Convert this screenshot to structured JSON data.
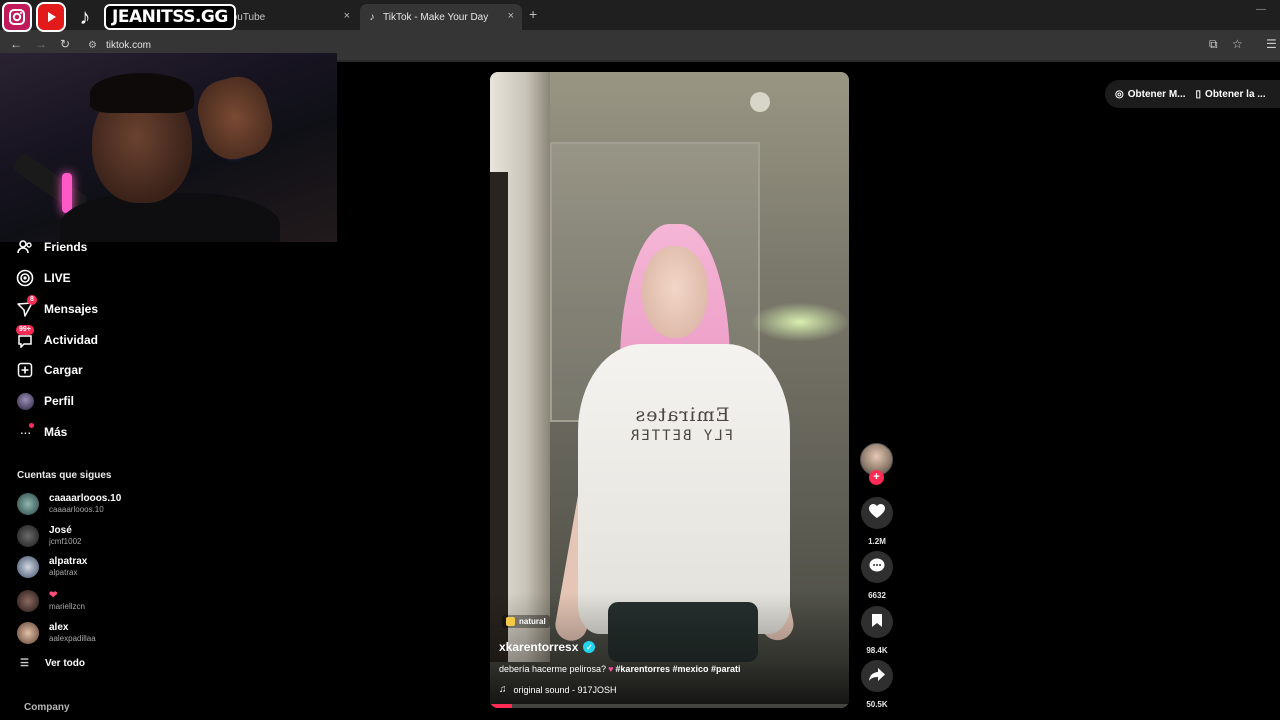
{
  "browser": {
    "tabs": [
      {
        "label": "(163) YouTube",
        "close": "×"
      },
      {
        "label": "TikTok - Make Your Day",
        "close": "×"
      }
    ],
    "new_tab": "+",
    "window_minimize": "—",
    "url": "tiktok.com"
  },
  "overlay": {
    "channel_name": "JEANITSS.GG"
  },
  "sidebar": {
    "nav": [
      {
        "label": "Friends",
        "icon": "friends-icon"
      },
      {
        "label": "LIVE",
        "icon": "live-icon"
      },
      {
        "label": "Mensajes",
        "icon": "messages-icon",
        "badge": "8"
      },
      {
        "label": "Actividad",
        "icon": "activity-icon",
        "badge": "99+"
      },
      {
        "label": "Cargar",
        "icon": "upload-icon"
      },
      {
        "label": "Perfil",
        "icon": "profile-icon"
      },
      {
        "label": "Más",
        "icon": "more-icon"
      }
    ],
    "following_title": "Cuentas que sigues",
    "following": [
      {
        "name": "caaaarlooos.10",
        "username": "caaaarlooos.10"
      },
      {
        "name": "José",
        "username": "jcmf1002"
      },
      {
        "name": "alpatrax",
        "username": "alpatrax"
      },
      {
        "name": "❤",
        "username": "mariellzcn"
      },
      {
        "name": "alex",
        "username": "aalexpadillaa"
      }
    ],
    "see_all": "Ver todo",
    "company": "Company"
  },
  "video": {
    "shirt_text_1": "Emirates",
    "shirt_text_2": "FLY BETTER",
    "tag": "natural",
    "author": "xkarentorresx",
    "description": "debería hacerme pelirosa?",
    "hashtags": "#karentorres #mexico #parati",
    "sound": "original sound - 917JOSH",
    "progress": 0.06
  },
  "actions": {
    "likes": "1.2M",
    "comments": "6632",
    "saves": "98.4K",
    "shares": "50.5K"
  },
  "top_right": {
    "pill_1": "Obtener M...",
    "pill_2": "Obtener la ..."
  },
  "colors": {
    "accent": "#fe2c55",
    "verified": "#20d5ec"
  }
}
